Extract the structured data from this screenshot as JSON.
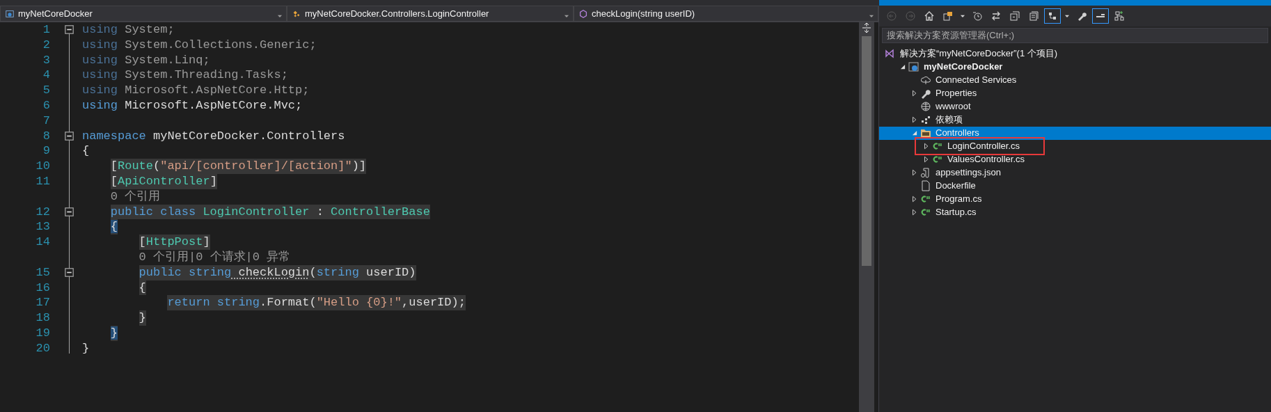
{
  "navigation_bar": [
    {
      "kind": "project",
      "text": "myNetCoreDocker"
    },
    {
      "kind": "class",
      "text": "myNetCoreDocker.Controllers.LoginController"
    },
    {
      "kind": "method",
      "text": "checkLogin(string userID)"
    }
  ],
  "code_lines": [
    {
      "kind": "code",
      "number": "1",
      "fold": true,
      "faded": true,
      "highlighted": false,
      "tokens": [
        {
          "kind": "keyword",
          "text": "using"
        },
        {
          "kind": "plain",
          "text": " System;"
        }
      ]
    },
    {
      "kind": "code",
      "number": "2",
      "fold": false,
      "faded": true,
      "highlighted": false,
      "tokens": [
        {
          "kind": "keyword",
          "text": "using"
        },
        {
          "kind": "plain",
          "text": " System.Collections.Generic;"
        }
      ]
    },
    {
      "kind": "code",
      "number": "3",
      "fold": false,
      "faded": true,
      "highlighted": false,
      "tokens": [
        {
          "kind": "keyword",
          "text": "using"
        },
        {
          "kind": "plain",
          "text": " System.Linq;"
        }
      ]
    },
    {
      "kind": "code",
      "number": "4",
      "fold": false,
      "faded": true,
      "highlighted": false,
      "tokens": [
        {
          "kind": "keyword",
          "text": "using"
        },
        {
          "kind": "plain",
          "text": " System.Threading.Tasks;"
        }
      ]
    },
    {
      "kind": "code",
      "number": "5",
      "fold": false,
      "faded": true,
      "highlighted": false,
      "tokens": [
        {
          "kind": "keyword",
          "text": "using"
        },
        {
          "kind": "plain",
          "text": " Microsoft.AspNetCore.Http;"
        }
      ]
    },
    {
      "kind": "code",
      "number": "6",
      "fold": false,
      "faded": false,
      "highlighted": false,
      "tokens": [
        {
          "kind": "keyword",
          "text": "using"
        },
        {
          "kind": "plain",
          "text": " Microsoft.AspNetCore.Mvc;"
        }
      ]
    },
    {
      "kind": "code",
      "number": "7",
      "fold": false
    },
    {
      "kind": "code",
      "number": "8",
      "fold": true,
      "faded": false,
      "highlighted": false,
      "tokens": [
        {
          "kind": "keyword",
          "text": "namespace"
        },
        {
          "kind": "plain",
          "text": " myNetCoreDocker.Controllers"
        }
      ]
    },
    {
      "kind": "code",
      "number": "9",
      "fold": false,
      "faded": false,
      "highlighted": false,
      "tokens": [
        {
          "kind": "open",
          "text": "{",
          "matched": false
        }
      ]
    },
    {
      "kind": "code",
      "number": "10",
      "fold": false,
      "faded": false,
      "highlighted": true,
      "tokens": [
        {
          "kind": "plain",
          "text": "["
        },
        {
          "kind": "type",
          "text": "Route"
        },
        {
          "kind": "plain",
          "text": "("
        },
        {
          "kind": "string",
          "text": "\"api/[controller]/[action]\""
        },
        {
          "kind": "plain",
          "text": ")]"
        }
      ]
    },
    {
      "kind": "code",
      "number": "11",
      "fold": false,
      "faded": false,
      "highlighted": true,
      "tokens": [
        {
          "kind": "plain",
          "text": "["
        },
        {
          "kind": "type",
          "text": "ApiController"
        },
        {
          "kind": "plain",
          "text": "]"
        }
      ]
    },
    {
      "kind": "codelens",
      "tokens": [
        {
          "kind": "plain",
          "text": "0 个引用"
        }
      ]
    },
    {
      "kind": "code",
      "number": "12",
      "fold": true,
      "faded": false,
      "highlighted": true,
      "tokens": [
        {
          "kind": "keyword",
          "text": "public class"
        },
        {
          "kind": "type",
          "text": " LoginController"
        },
        {
          "kind": "plain",
          "text": " : "
        },
        {
          "kind": "type",
          "text": "ControllerBase"
        }
      ]
    },
    {
      "kind": "code",
      "number": "13",
      "fold": false,
      "faded": false,
      "highlighted": true,
      "tokens": [
        {
          "kind": "open",
          "text": "{",
          "matched": true
        }
      ]
    },
    {
      "kind": "code",
      "number": "14",
      "fold": false,
      "faded": false,
      "highlighted": true,
      "tokens": [
        {
          "kind": "plain",
          "text": "["
        },
        {
          "kind": "type",
          "text": "HttpPost"
        },
        {
          "kind": "plain",
          "text": "]"
        }
      ]
    },
    {
      "kind": "codelens",
      "tokens": [
        {
          "kind": "plain",
          "text": "0 个引用|0 个请求|0 异常"
        }
      ]
    },
    {
      "kind": "code",
      "number": "15",
      "fold": true,
      "faded": false,
      "highlighted": true,
      "tokens": [
        {
          "kind": "keyword",
          "text": "public string"
        },
        {
          "kind": "method",
          "text": " checkLogin"
        },
        {
          "kind": "plain",
          "text": "("
        },
        {
          "kind": "keyword",
          "text": "string"
        },
        {
          "kind": "plain",
          "text": " userID)"
        }
      ]
    },
    {
      "kind": "code",
      "number": "16",
      "fold": false,
      "faded": false,
      "highlighted": true,
      "tokens": [
        {
          "kind": "open",
          "text": "{",
          "matched": false
        }
      ]
    },
    {
      "kind": "code",
      "number": "17",
      "fold": false,
      "faded": false,
      "highlighted": true,
      "tokens": [
        {
          "kind": "keyword",
          "text": "return string"
        },
        {
          "kind": "plain",
          "text": ".Format("
        },
        {
          "kind": "string",
          "text": "\"Hello {0}!\""
        },
        {
          "kind": "plain",
          "text": ",userID);"
        }
      ]
    },
    {
      "kind": "code",
      "number": "18",
      "fold": false,
      "faded": false,
      "highlighted": true,
      "tokens": [
        {
          "kind": "close",
          "text": "}",
          "matched": false
        }
      ]
    },
    {
      "kind": "code",
      "number": "19",
      "fold": false,
      "faded": false,
      "highlighted": true,
      "tokens": [
        {
          "kind": "close",
          "text": "}",
          "matched": true
        }
      ]
    },
    {
      "kind": "code",
      "number": "20",
      "fold": false,
      "faded": false,
      "highlighted": false,
      "tokens": [
        {
          "kind": "close",
          "text": "}",
          "matched": false
        }
      ]
    }
  ],
  "solution_explorer": {
    "toolbar": [
      {
        "kind": "back",
        "disabled": true,
        "on": false
      },
      {
        "kind": "forward",
        "disabled": true,
        "on": false
      },
      {
        "kind": "home",
        "disabled": false,
        "on": false
      },
      {
        "kind": "sync",
        "disabled": false,
        "on": false
      },
      {
        "kind": "caret",
        "disabled": false,
        "on": false
      },
      {
        "kind": "history",
        "disabled": false,
        "on": false
      },
      {
        "kind": "swap",
        "disabled": false,
        "on": false
      },
      {
        "kind": "collapse",
        "disabled": false,
        "on": false
      },
      {
        "kind": "pages",
        "disabled": false,
        "on": false
      },
      {
        "kind": "pending",
        "disabled": false,
        "on": true
      },
      {
        "kind": "caret",
        "disabled": false,
        "on": false
      },
      {
        "kind": "wrench",
        "disabled": false,
        "on": false
      },
      {
        "kind": "preview",
        "disabled": false,
        "on": true
      },
      {
        "kind": "diagram",
        "disabled": false,
        "on": false
      }
    ],
    "search": {
      "placeholder": "搜索解决方案资源管理器(Ctrl+;)"
    },
    "tree": [
      {
        "kind": "solution",
        "label": "解决方案“myNetCoreDocker”(1 个项目)",
        "selected": false,
        "bold": false,
        "marked": false,
        "children": [
          {
            "kind": "project",
            "label": "myNetCoreDocker",
            "expanded": true,
            "selected": false,
            "bold": true,
            "marked": false,
            "children": [
              {
                "kind": "cloud",
                "label": "Connected Services",
                "selected": false,
                "bold": false,
                "marked": false
              },
              {
                "kind": "wrench",
                "label": "Properties",
                "expanded": false,
                "selected": false,
                "bold": false,
                "marked": false
              },
              {
                "kind": "globe",
                "label": "wwwroot",
                "selected": false,
                "bold": false,
                "marked": false
              },
              {
                "kind": "dependencies",
                "label": "依赖项",
                "expanded": false,
                "selected": false,
                "bold": false,
                "marked": false
              },
              {
                "kind": "folder",
                "label": "Controllers",
                "expanded": true,
                "selected": true,
                "bold": false,
                "marked": false,
                "children": [
                  {
                    "kind": "csharp",
                    "label": "LoginController.cs",
                    "expanded": false,
                    "selected": false,
                    "bold": false,
                    "marked": true
                  },
                  {
                    "kind": "csharp",
                    "label": "ValuesController.cs",
                    "expanded": false,
                    "selected": false,
                    "bold": false,
                    "marked": false
                  }
                ]
              },
              {
                "kind": "json",
                "label": "appsettings.json",
                "expanded": false,
                "selected": false,
                "bold": false,
                "marked": false
              },
              {
                "kind": "file",
                "label": "Dockerfile",
                "selected": false,
                "bold": false,
                "marked": false
              },
              {
                "kind": "csharp",
                "label": "Program.cs",
                "expanded": false,
                "selected": false,
                "bold": false,
                "marked": false
              },
              {
                "kind": "csharp",
                "label": "Startup.cs",
                "expanded": false,
                "selected": false,
                "bold": false,
                "marked": false
              }
            ]
          }
        ]
      }
    ]
  }
}
